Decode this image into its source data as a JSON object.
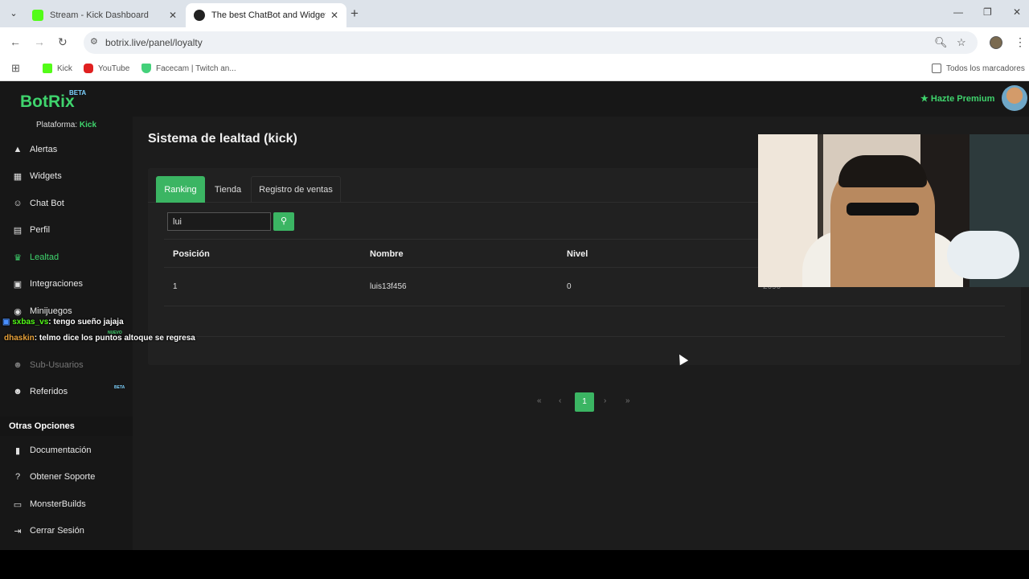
{
  "browser": {
    "tabs": [
      {
        "title": "Stream - Kick Dashboard",
        "favicon_color": "#53fc18"
      },
      {
        "title": "The best ChatBot and Widgets f",
        "favicon_color": "#222222"
      }
    ],
    "url": "botrix.live/panel/loyalty",
    "bookmarks": [
      "Kick",
      "YouTube",
      "Facecam | Twitch an...",
      "Todos los marcadores"
    ]
  },
  "app": {
    "logo": "BotRix",
    "logo_badge": "BETA",
    "premium_label": "Hazte Premium",
    "platform_label": "Plataforma:",
    "platform_value": "Kick",
    "accent_color": "#3bb563"
  },
  "sidebar": {
    "items": [
      {
        "label": "Alertas",
        "icon": "warning-icon"
      },
      {
        "label": "Widgets",
        "icon": "widgets-icon"
      },
      {
        "label": "Chat Bot",
        "icon": "robot-icon"
      },
      {
        "label": "Perfil",
        "icon": "id-card-icon"
      },
      {
        "label": "Lealtad",
        "icon": "trophy-icon"
      },
      {
        "label": "Integraciones",
        "icon": "plug-icon"
      },
      {
        "label": "Minijuegos",
        "icon": "gamepad-icon"
      },
      {
        "label": "Sub-Usuarios",
        "icon": "users-icon"
      },
      {
        "label": "Referidos",
        "icon": "user-group-icon",
        "badge": "BETA"
      }
    ],
    "nuevo_badge": "NUEVO",
    "section_title": "Otras Opciones",
    "other_items": [
      {
        "label": "Documentación",
        "icon": "book-icon"
      },
      {
        "label": "Obtener Soporte",
        "icon": "question-icon"
      },
      {
        "label": "MonsterBuilds",
        "icon": "laptop-icon"
      },
      {
        "label": "Cerrar Sesión",
        "icon": "logout-icon"
      }
    ]
  },
  "chat_overlay": [
    {
      "user": "sxbas_vs",
      "message": ": tengo sueño jajaja",
      "user_color": "#53fc18"
    },
    {
      "user": "dhaskin",
      "message": ": telmo dice los puntos altoque se regresa",
      "user_color": "#e8a23a"
    }
  ],
  "page": {
    "title": "Sistema de lealtad (kick)",
    "tabs": [
      "Ranking",
      "Tienda",
      "Registro de ventas"
    ],
    "active_tab": "Ranking",
    "search_value": "lui",
    "table": {
      "columns": [
        "Posición",
        "Nombre",
        "Nivel"
      ],
      "rows": [
        {
          "posicion": "1",
          "nombre": "luis13f456",
          "nivel": "0",
          "puntos": "2690"
        }
      ]
    },
    "pagination": {
      "current_page": "1"
    }
  }
}
